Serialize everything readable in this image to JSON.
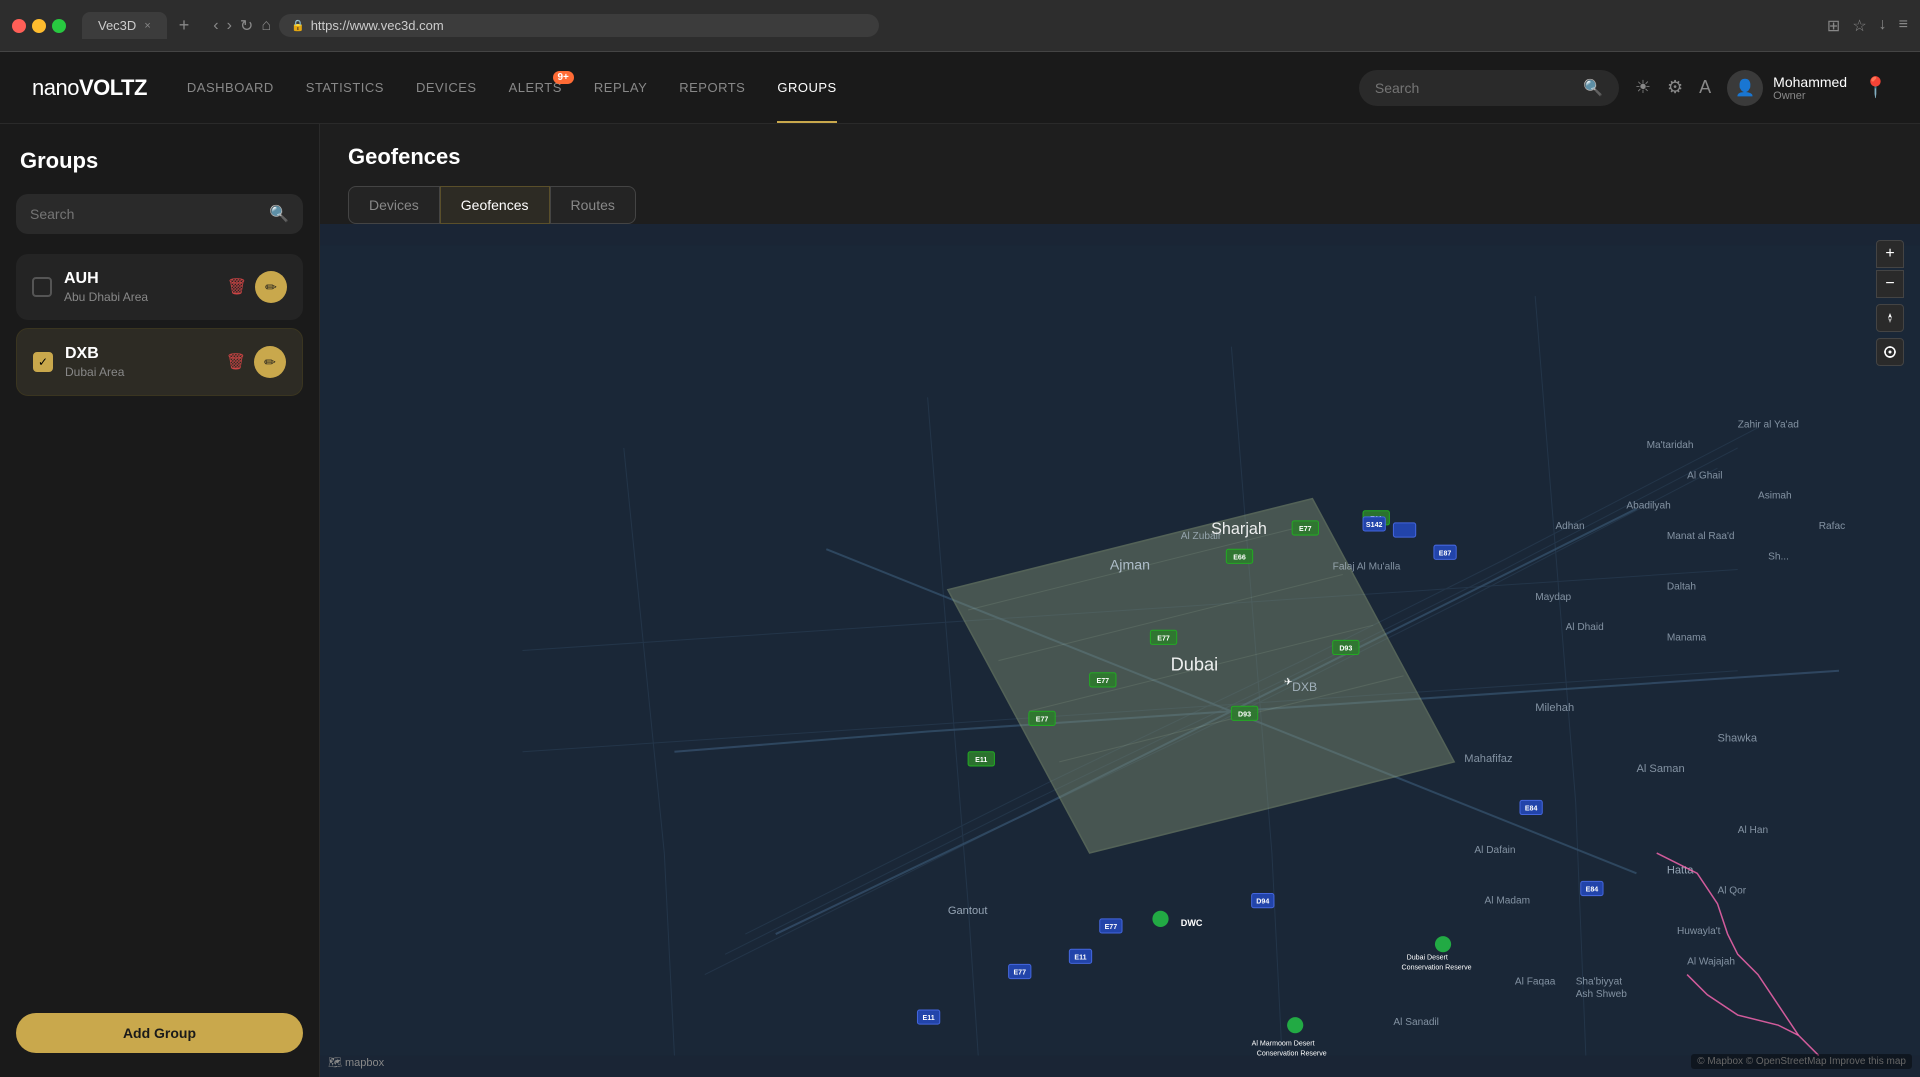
{
  "browser": {
    "tab_title": "Vec3D",
    "url": "https://www.vec3d.com",
    "new_tab_label": "+",
    "close_tab": "×"
  },
  "app": {
    "logo": "nanoVOLTZ",
    "nav": {
      "items": [
        {
          "id": "dashboard",
          "label": "DASHBOARD",
          "active": false
        },
        {
          "id": "statistics",
          "label": "STATISTICS",
          "active": false
        },
        {
          "id": "devices",
          "label": "DEVICES",
          "active": false
        },
        {
          "id": "alerts",
          "label": "ALERTS",
          "active": false,
          "badge": "9+"
        },
        {
          "id": "replay",
          "label": "REPLAY",
          "active": false
        },
        {
          "id": "reports",
          "label": "REPORTS",
          "active": false
        },
        {
          "id": "groups",
          "label": "GROUPS",
          "active": true
        }
      ]
    },
    "search": {
      "placeholder": "Search",
      "label": "Search"
    },
    "user": {
      "name": "Mohammed",
      "role": "Owner"
    }
  },
  "sidebar": {
    "title": "Groups",
    "search_placeholder": "Search",
    "groups": [
      {
        "id": "auh",
        "name": "AUH",
        "description": "Abu Dhabi Area",
        "checked": false,
        "selected": false
      },
      {
        "id": "dxb",
        "name": "DXB",
        "description": "Dubai Area",
        "checked": true,
        "selected": true
      }
    ],
    "add_group_label": "Add Group"
  },
  "content": {
    "page_title": "Geofences",
    "tabs": [
      {
        "id": "devices",
        "label": "Devices",
        "active": false
      },
      {
        "id": "geofences",
        "label": "Geofences",
        "active": true
      },
      {
        "id": "routes",
        "label": "Routes",
        "active": false
      }
    ]
  },
  "map": {
    "zoom_in": "+",
    "zoom_out": "−",
    "compass": "↑",
    "locate": "◎",
    "attribution": "© Mapbox © OpenStreetMap  Improve this map",
    "logo": "mapbox",
    "cities": [
      "Sharjah",
      "Dubai",
      "Ajman",
      "Al Zubair",
      "Mahafifaz",
      "Milehah",
      "Al Dafain",
      "Al Madam",
      "Gantout",
      "Hatta"
    ],
    "dxb_label": "DXB"
  }
}
